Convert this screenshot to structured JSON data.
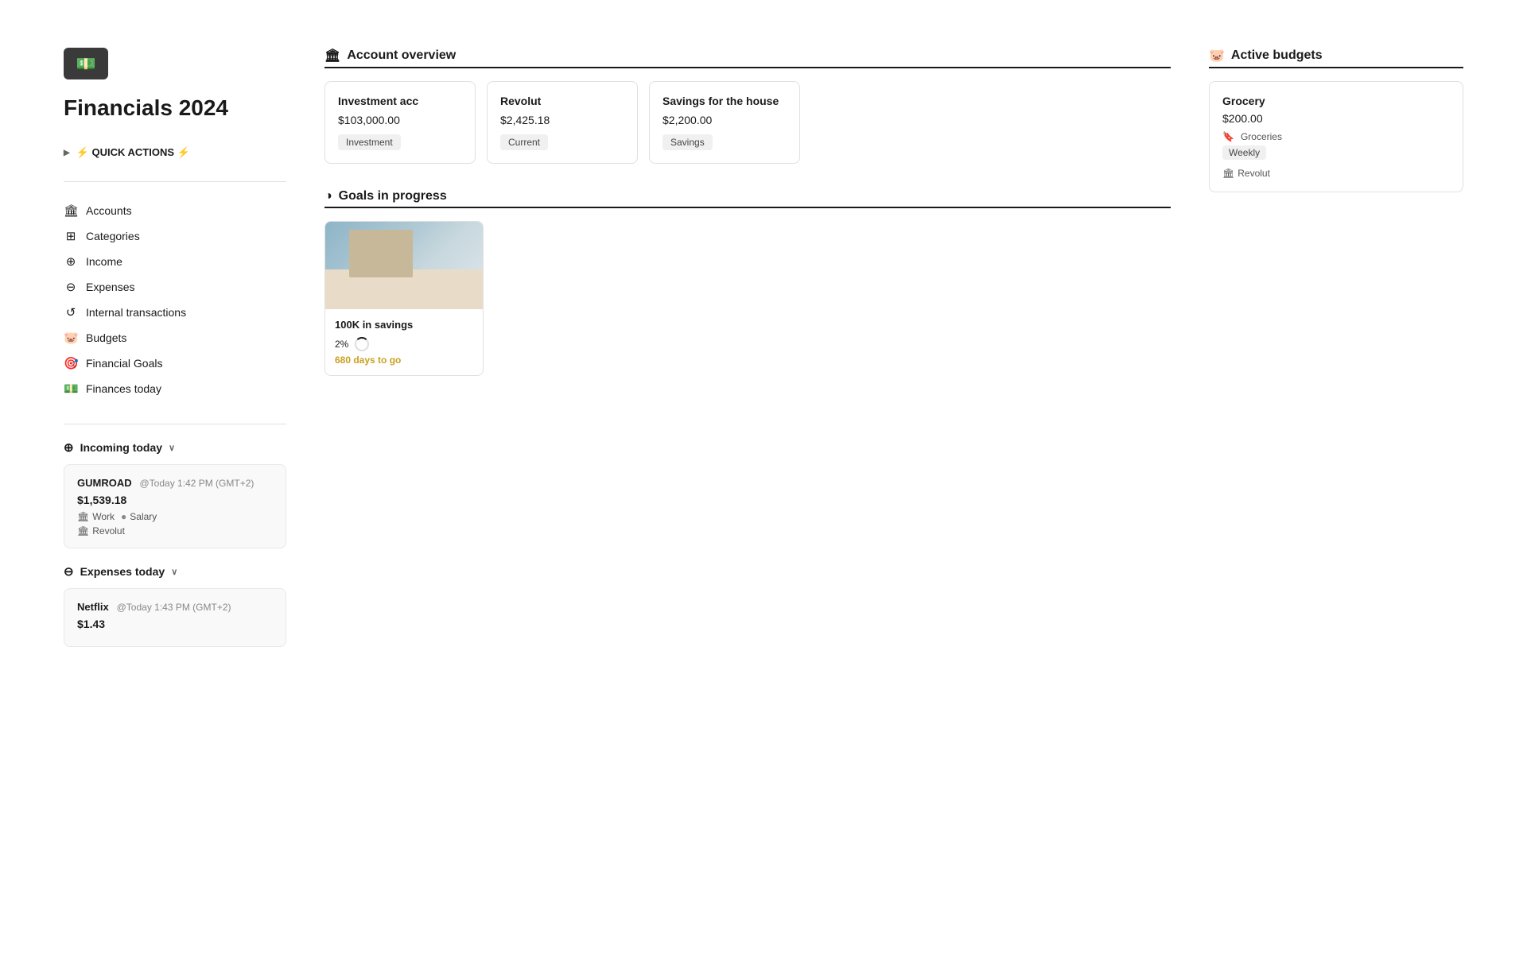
{
  "app": {
    "title": "Financials 2024",
    "icon": "💵"
  },
  "quick_actions": {
    "label": "⚡ QUICK ACTIONS ⚡",
    "arrow": "▶"
  },
  "nav": {
    "items": [
      {
        "id": "accounts",
        "label": "Accounts",
        "icon": "🏛"
      },
      {
        "id": "categories",
        "label": "Categories",
        "icon": "⊞"
      },
      {
        "id": "income",
        "label": "Income",
        "icon": "⊕"
      },
      {
        "id": "expenses",
        "label": "Expenses",
        "icon": "⊖"
      },
      {
        "id": "internal-transactions",
        "label": "Internal transactions",
        "icon": "↺"
      },
      {
        "id": "budgets",
        "label": "Budgets",
        "icon": "🐷"
      },
      {
        "id": "financial-goals",
        "label": "Financial Goals",
        "icon": "🎯"
      },
      {
        "id": "finances-today",
        "label": "Finances today",
        "icon": "💵"
      }
    ]
  },
  "incoming_today": {
    "label": "Incoming today",
    "chevron": "∨",
    "transactions": [
      {
        "name": "GUMROAD",
        "time": "@Today 1:42 PM (GMT+2)",
        "amount": "$1,539.18",
        "tags": [
          {
            "icon": "🏛",
            "label": "Work"
          },
          {
            "icon": "●",
            "label": "Salary"
          }
        ],
        "bank": "Revolut"
      }
    ]
  },
  "expenses_today": {
    "label": "Expenses today",
    "chevron": "∨",
    "transactions": [
      {
        "name": "Netflix",
        "time": "@Today 1:43 PM (GMT+2)",
        "amount": "$1.43"
      }
    ]
  },
  "account_overview": {
    "title": "Account overview",
    "icon": "🏛",
    "accounts": [
      {
        "name": "Investment acc",
        "balance": "$103,000.00",
        "type": "Investment"
      },
      {
        "name": "Revolut",
        "balance": "$2,425.18",
        "type": "Current"
      },
      {
        "name": "Savings for the house",
        "balance": "$2,200.00",
        "type": "Savings"
      }
    ]
  },
  "active_budgets": {
    "title": "Active budgets",
    "icon": "🐷",
    "budgets": [
      {
        "name": "Grocery",
        "amount": "$200.00",
        "category": "Groceries",
        "category_icon": "🔖",
        "period": "Weekly",
        "bank": "Revolut",
        "bank_icon": "🏛"
      }
    ]
  },
  "goals_in_progress": {
    "title": "Goals in progress",
    "icon": "◑",
    "goals": [
      {
        "name": "100K in savings",
        "progress_percent": "2%",
        "days_to_go": "680 days to go"
      }
    ]
  },
  "finances_today": {
    "label": "Finances today"
  },
  "internal_transactions": {
    "label": "Internal transactions"
  }
}
